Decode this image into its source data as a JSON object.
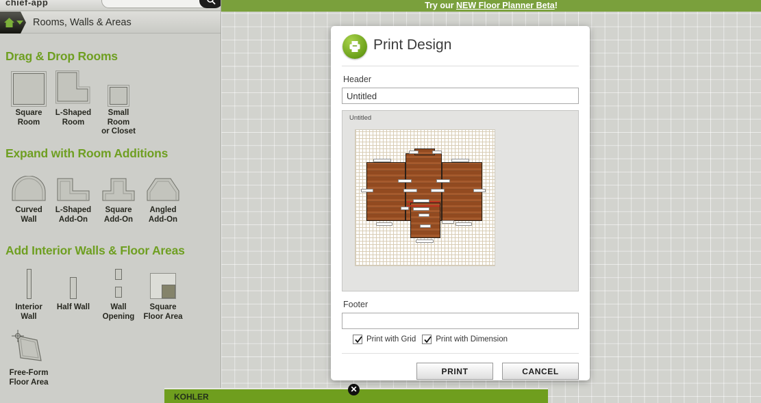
{
  "app": {
    "title": "chief-app",
    "search_placeholder": "",
    "search_value": ""
  },
  "top_banner": {
    "text_before": "Try our",
    "link_text": "NEW Floor Planner Beta",
    "text_after": "!"
  },
  "breadcrumb": {
    "home_icon": "home-icon",
    "chevron_icon": "chevron-down-icon",
    "label": "Rooms, Walls & Areas"
  },
  "sidebar": {
    "groups": [
      {
        "title": "Drag & Drop Rooms",
        "items": [
          {
            "label": "Square\nRoom",
            "icon": "square-room-icon"
          },
          {
            "label": "L-Shaped\nRoom",
            "icon": "l-shaped-room-icon"
          },
          {
            "label": "Small Room\nor Closet",
            "icon": "small-room-icon"
          }
        ]
      },
      {
        "title": "Expand with Room Additions",
        "items": [
          {
            "label": "Curved Wall",
            "icon": "curved-wall-icon"
          },
          {
            "label": "L-Shaped\nAdd-On",
            "icon": "l-shaped-addon-icon"
          },
          {
            "label": "Square\nAdd-On",
            "icon": "square-addon-icon"
          },
          {
            "label": "Angled\nAdd-On",
            "icon": "angled-addon-icon"
          }
        ]
      },
      {
        "title": "Add Interior Walls & Floor Areas",
        "items": [
          {
            "label": "Interior\nWall",
            "icon": "interior-wall-icon"
          },
          {
            "label": "Half Wall",
            "icon": "half-wall-icon"
          },
          {
            "label": "Wall\nOpening",
            "icon": "wall-opening-icon"
          },
          {
            "label": "Square\nFloor Area",
            "icon": "square-floor-area-icon"
          },
          {
            "label": "Free-Form\nFloor Area",
            "icon": "free-form-floor-area-icon"
          }
        ]
      }
    ]
  },
  "bottom_ad": {
    "text": "KOHLER",
    "close_label": "✕"
  },
  "modal": {
    "icon": "printer-icon",
    "title": "Print Design",
    "header_label": "Header",
    "header_value": "Untitled",
    "preview_title": "Untitled",
    "footer_label": "Footer",
    "footer_value": "",
    "footer_placeholder": "",
    "checkboxes": [
      {
        "label": "Print with Grid",
        "checked": true
      },
      {
        "label": "Print with Dimension",
        "checked": true
      }
    ],
    "print_button": "PRINT",
    "cancel_button": "CANCEL"
  },
  "colors": {
    "accent_green": "#6f9f22",
    "banner_green": "#7aa03c",
    "wood": "#9a4d22",
    "wall": "#231f16"
  }
}
